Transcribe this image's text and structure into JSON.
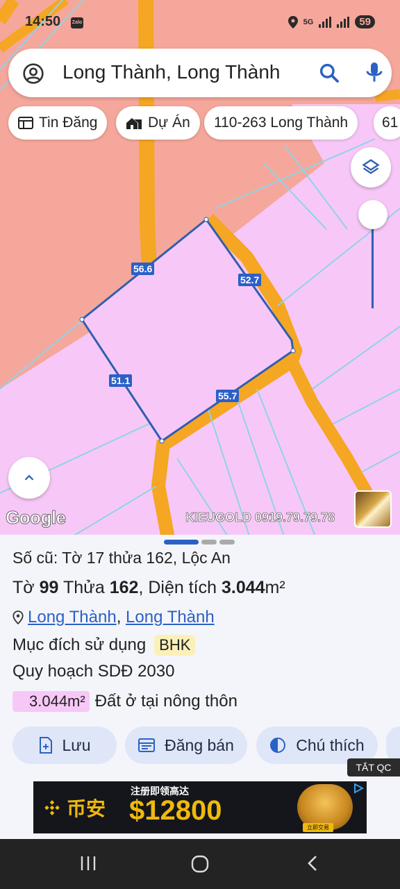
{
  "status_bar": {
    "time": "14:50",
    "notification_app": "Zalo",
    "network": "5G",
    "battery": "59",
    "icons": [
      "location-icon",
      "5g-icon",
      "signal-icon",
      "signal-icon"
    ]
  },
  "search": {
    "query": "Long Thành, Long Thành",
    "icons": [
      "account-circle-icon",
      "search-icon",
      "mic-icon"
    ]
  },
  "chips": [
    {
      "label": "Tin Đăng",
      "icon": "newspaper-icon"
    },
    {
      "label": "Dự Án",
      "icon": "house-icon"
    },
    {
      "label": "110-263 Long Thành",
      "icon": ""
    },
    {
      "label": "61",
      "icon": ""
    }
  ],
  "map": {
    "dimensions": [
      "56.6",
      "52.7",
      "51.1",
      "55.7"
    ],
    "logo": "Google",
    "watermark": "KIEUGOLD 0919.79.79.78",
    "colors": {
      "residential": "#f7c8f7",
      "agricultural": "#f6a79b",
      "road": "#f5a623",
      "parcel_edge": "#2e5fb0",
      "plot_line": "#8fd3e8"
    }
  },
  "sheet": {
    "old_ref": "Số cũ: Tờ 17 thửa 162, Lộc An",
    "sheet_label": "Tờ",
    "sheet_no": "99",
    "parcel_label": "Thửa",
    "parcel_no": "162",
    "area_label": "Diện tích",
    "area_value": "3.044",
    "area_unit": "m²",
    "location_a": "Long Thành",
    "location_sep": ",",
    "location_b": "Long Thành",
    "purpose_label": "Mục đích sử dụng",
    "purpose_code": "BHK",
    "plan_label": "Quy hoạch SDĐ 2030",
    "plan_area": "3.044m²",
    "plan_type": "Đất ở tại nông thôn"
  },
  "actions": [
    {
      "label": "Lưu",
      "icon": "add-doc-icon"
    },
    {
      "label": "Đăng bán",
      "icon": "listing-icon"
    },
    {
      "label": "Chú thích",
      "icon": "contrast-icon"
    }
  ],
  "ad": {
    "close_label": "TẮT QC",
    "brand": "币安",
    "headline_cn": "注册即领高达",
    "amount": "$12800",
    "cta": "立即交易"
  },
  "nav": {
    "icons": [
      "recent-apps-icon",
      "home-icon",
      "back-icon"
    ]
  }
}
